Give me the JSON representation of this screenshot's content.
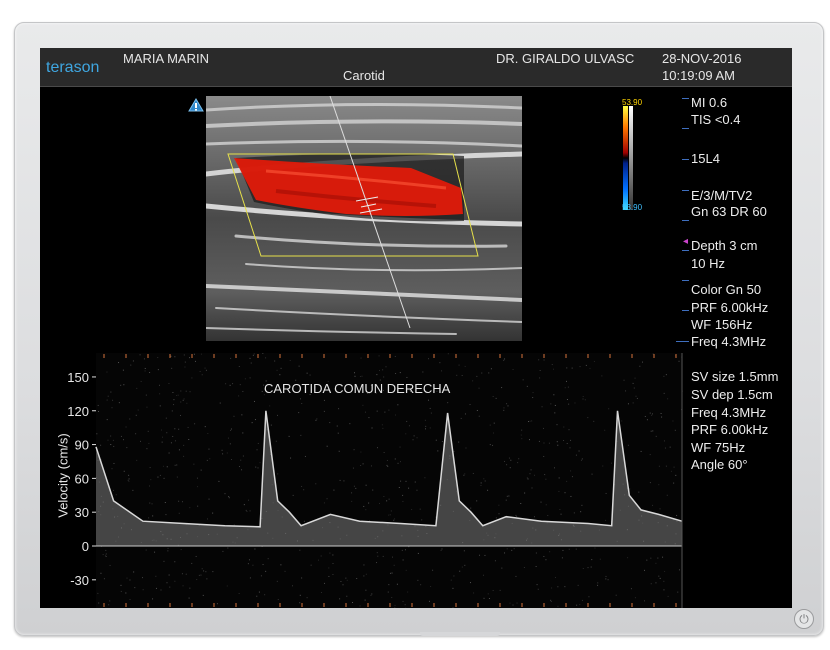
{
  "header": {
    "brand": "terason",
    "patient_name": "MARIA MARIN",
    "exam": "Carotid",
    "doctor": "DR. GIRALDO ULVASC",
    "date": "28-NOV-2016",
    "time": "10:19:09 AM"
  },
  "color_scale": {
    "top": "53.90",
    "bottom": "53.90"
  },
  "params_top": [
    "MI  0.6",
    "TIS <0.4",
    "15L4",
    "E/3/M/TV2",
    "Gn 63   DR 60",
    "Depth 3 cm",
    "10 Hz",
    "Color  Gn 50",
    "PRF 6.00kHz",
    "WF 156Hz",
    "Freq 4.3MHz"
  ],
  "params_bottom": [
    "SV size 1.5mm",
    "SV dep 1.5cm",
    "Freq 4.3MHz",
    "PRF 6.00kHz",
    "WF 75Hz",
    "Angle 60°"
  ],
  "spectral": {
    "label": "CAROTIDA COMUN DERECHA",
    "axis_label": "Velocity (cm/s)",
    "ticks": [
      "150",
      "120",
      "90",
      "60",
      "30",
      "0",
      "-30"
    ]
  },
  "chart_data": {
    "type": "line",
    "title": "CAROTIDA COMUN DERECHA",
    "xlabel": "",
    "ylabel": "Velocity (cm/s)",
    "ylim": [
      -40,
      160
    ],
    "y_ticks": [
      150,
      120,
      90,
      60,
      30,
      0,
      -30
    ],
    "series": [
      {
        "values": [
          [
            0,
            88
          ],
          [
            0.03,
            40
          ],
          [
            0.08,
            22
          ],
          [
            0.15,
            20
          ],
          [
            0.22,
            18
          ],
          [
            0.28,
            17
          ],
          [
            0.29,
            120
          ],
          [
            0.31,
            40
          ],
          [
            0.33,
            30
          ],
          [
            0.35,
            18
          ],
          [
            0.4,
            28
          ],
          [
            0.45,
            22
          ],
          [
            0.52,
            20
          ],
          [
            0.58,
            18
          ],
          [
            0.6,
            118
          ],
          [
            0.62,
            40
          ],
          [
            0.64,
            30
          ],
          [
            0.66,
            18
          ],
          [
            0.7,
            26
          ],
          [
            0.76,
            22
          ],
          [
            0.84,
            20
          ],
          [
            0.88,
            18
          ],
          [
            0.89,
            120
          ],
          [
            0.91,
            45
          ],
          [
            0.93,
            32
          ],
          [
            0.96,
            28
          ],
          [
            1.0,
            22
          ]
        ]
      }
    ]
  },
  "colors": {
    "brand": "#3fa6e0",
    "flow_red": "#e01a0a",
    "roi_yellow": "#e6e04a",
    "tick_orange": "#d8743a",
    "marker_blue": "#3f6fbf"
  },
  "icons": {
    "info": "info-icon",
    "power": "power-button-icon"
  }
}
